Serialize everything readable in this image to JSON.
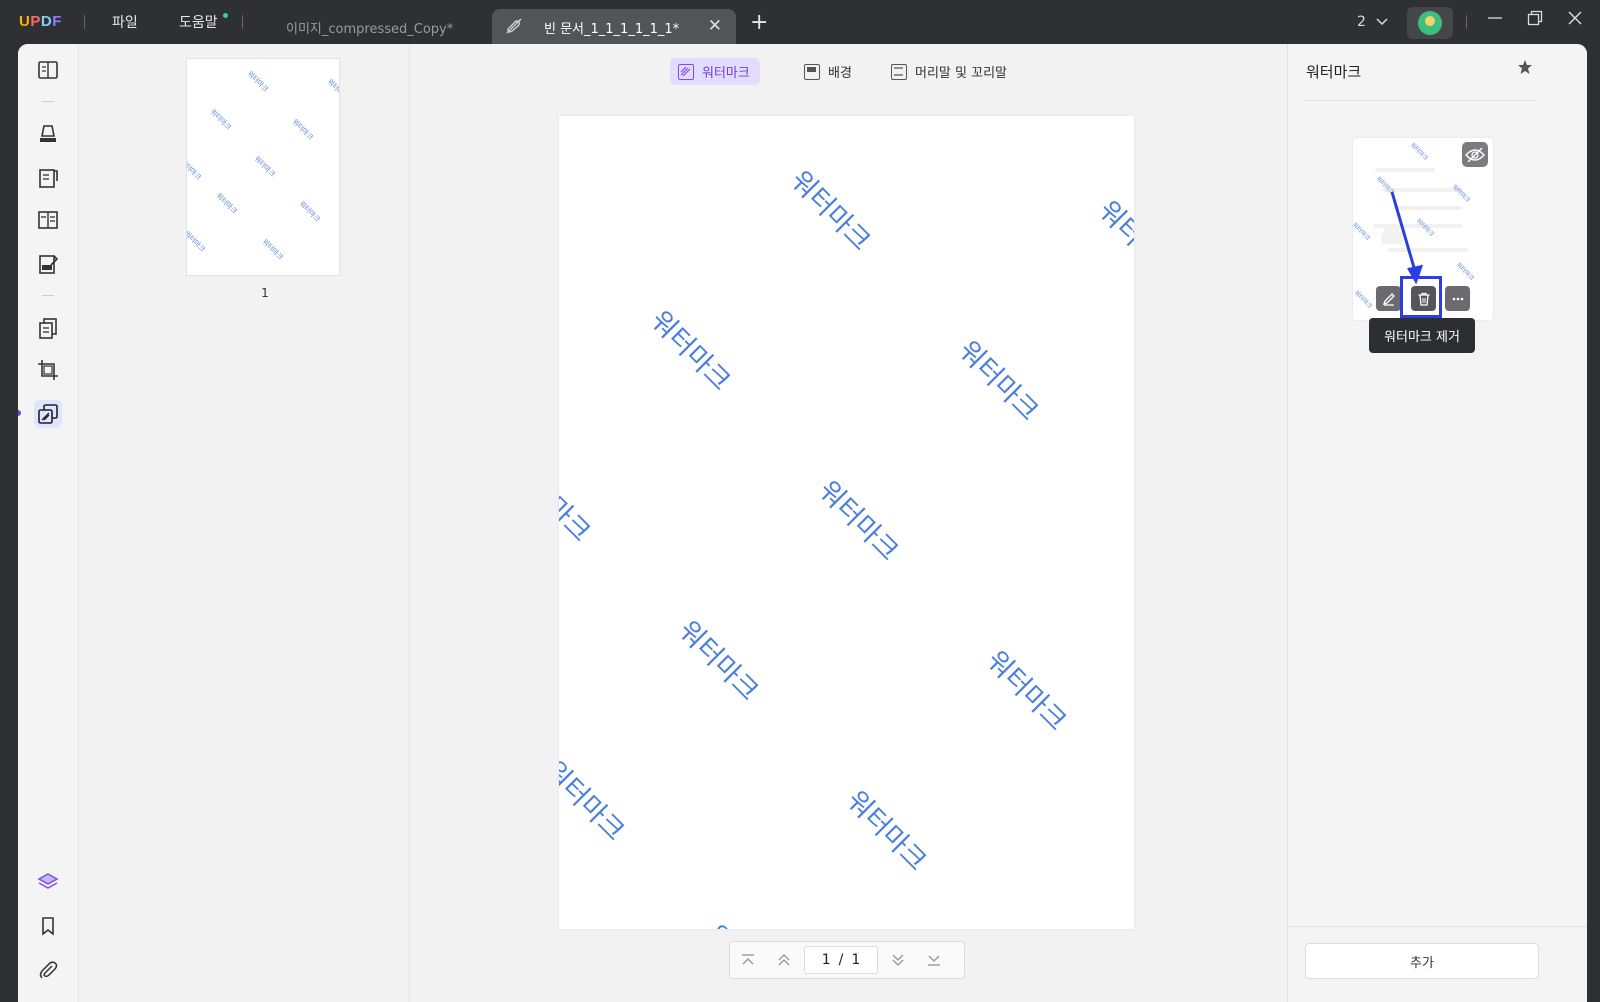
{
  "app": {
    "logo": {
      "u": "U",
      "p": "P",
      "d": "D",
      "f": "F"
    },
    "menu": {
      "file": "파일",
      "help": "도움말"
    }
  },
  "tabs": [
    {
      "label": "이미지_compressed_Copy*",
      "active": false
    },
    {
      "label": "빈 문서_1_1_1_1_1_1*",
      "active": true
    }
  ],
  "window": {
    "count": "2"
  },
  "toolbar": {
    "tabs": [
      {
        "label": "워터마크",
        "active": true
      },
      {
        "label": "배경",
        "active": false
      },
      {
        "label": "머리말 및 꼬리말",
        "active": false
      }
    ]
  },
  "thumbnails": {
    "page_label": "1"
  },
  "document": {
    "watermark_text": "워터마크",
    "watermarks": [
      "워터마크",
      "워터마크",
      "워터마크",
      "워터마크",
      "워터마크",
      "워터마크",
      "워터마크",
      "워터마크",
      "워터마크",
      "워터마크",
      "워터마크"
    ]
  },
  "pager": {
    "current": "1",
    "separator": "/",
    "total": "1"
  },
  "right_panel": {
    "title": "워터마크",
    "tooltip": "워터마크 제거",
    "add_button": "추가"
  },
  "colors": {
    "accent": "#6b3fe0",
    "watermark": "#4a7fe0",
    "highlight": "#2b3ee0"
  }
}
